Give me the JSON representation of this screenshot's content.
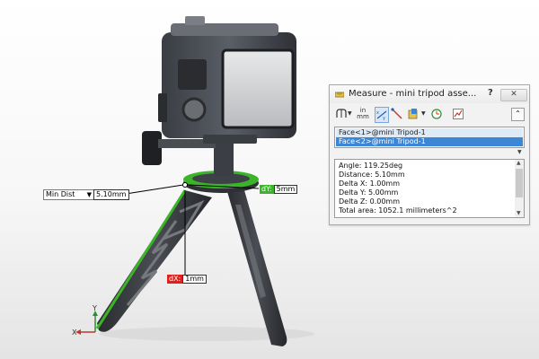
{
  "window": {
    "title": "Measure - mini tripod asse...",
    "help": "?",
    "close": "✕"
  },
  "toolbar": {
    "units_top": "in",
    "units_bottom": "mm",
    "collapse": "⌃"
  },
  "selections": [
    "Face<1>@mini Tripod-1",
    "Face<2>@mini Tripod-1"
  ],
  "results": [
    "Angle: 119.25deg",
    "Distance: 5.10mm",
    "Delta X: 1.00mm",
    "Delta Y: 5.00mm",
    "Delta Z: 0.00mm",
    "Total area: 1052.1 millimeters^2"
  ],
  "callouts": {
    "min_dist_select": "Min Dist",
    "min_dist_value": "5.10mm",
    "dx_top_tag": "dY:",
    "dx_top_value": "5mm",
    "dx_bottom_tag": "dX:",
    "dx_bottom_value": "1mm"
  },
  "axes": {
    "x": "X",
    "y": "Y"
  },
  "colors": {
    "highlight_green": "#3cb42a",
    "selection_blue": "#3c86d6",
    "delta_red": "#e0201b"
  }
}
